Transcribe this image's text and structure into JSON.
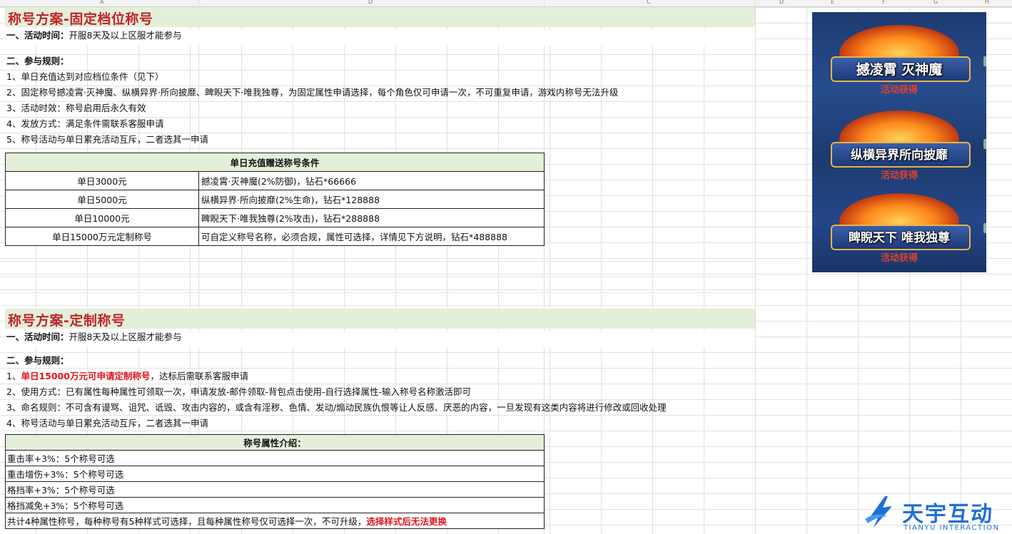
{
  "columns": [
    "A",
    "D",
    "C",
    "D",
    "E",
    "F",
    "G",
    "H"
  ],
  "section1": {
    "title": "称号方案-固定档位称号",
    "time_label": "一、活动时间：",
    "time_value": "开服8天及以上区服才能参与",
    "rules_label": "二、参与规则：",
    "rules": [
      "1、单日充值达到对应档位条件（见下）",
      "2、固定称号撼凌霄·灭神魔、纵横异界·所向披靡、睥睨天下·唯我独尊，为固定属性申请选择，每个角色仅可申请一次，不可重复申请，游戏内称号无法升级",
      "3、活动时效：称号启用后永久有效",
      "4、发放方式：满足条件需联系客服申请",
      "5、称号活动与单日累充活动互斥，二者选其一申请"
    ],
    "table_header": "单日充值赠送称号条件",
    "table_rows": [
      {
        "cond": "单日3000元",
        "reward": "撼凌霄·灭神魔(2%防御)，钻石*66666"
      },
      {
        "cond": "单日5000元",
        "reward": "纵横异界·所向披靡(2%生命)，钻石*128888"
      },
      {
        "cond": "单日10000元",
        "reward": "睥睨天下·唯我独尊(2%攻击)，钻石*288888"
      },
      {
        "cond": "单日15000万元定制称号",
        "reward": "可自定义称号名称，必须合规，属性可选择，详情见下方说明，钻石*488888"
      }
    ]
  },
  "section2": {
    "title": "称号方案-定制称号",
    "time_label": "一、活动时间：",
    "time_value": "开服8天及以上区服才能参与",
    "rules_label": "二、参与规则：",
    "rule1_prefix": "1、",
    "rule1_red": "单日15000万元可申请定制称号",
    "rule1_suffix": "，达标后需联系客服申请",
    "rules": [
      "2、使用方式：已有属性每种属性可领取一次，申请发放-邮件领取-背包点击使用-自行选择属性-输入称号名称激活即可",
      "3、命名规则：不可含有谩骂、诅咒、诋毁、攻击内容的，或含有淫秽、色情、发动/煽动民族仇恨等让人反感、厌恶的内容，一旦发现有这类内容将进行修改或回收处理",
      "4、称号活动与单日累充活动互斥，二者选其一申请"
    ],
    "table_header": "称号属性介绍：",
    "table_rows": [
      "重击率+3%：5个称号可选",
      "重击增伤+3%：5个称号可选",
      "格挡率+3%：5个称号可选",
      "格挡减免+3%：5个称号可选"
    ],
    "footer_text": "共计4种属性称号，每种称号有5种样式可选择，且每种属性称号仅可选择一次，不可升级，",
    "footer_red": "选择样式后无法更换"
  },
  "badges": [
    {
      "name": "撼凌霄  灭神魔",
      "sub": "活动获得"
    },
    {
      "name": "纵横异界所向披靡",
      "sub": "活动获得"
    },
    {
      "name": "睥睨天下 唯我独尊",
      "sub": "活动获得"
    }
  ],
  "logo": {
    "cn": "天宇互动",
    "en": "TIANYU INTERACTION"
  },
  "colors": {
    "title_red": "#c0242b",
    "highlight_red": "#e0141b",
    "band_green": "#e4efda",
    "logo_blue": "#1f6fd6"
  }
}
